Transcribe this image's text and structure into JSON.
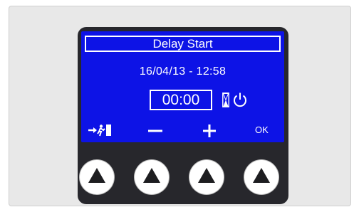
{
  "display": {
    "title": "Delay Start",
    "datetime": "16/04/13 - 12:58",
    "delay_time": "00:00",
    "status_icons": [
      "hourglass-icon",
      "power-icon"
    ]
  },
  "softkeys": {
    "exit_icon": "exit-arrow-icon",
    "minus_label": "−",
    "plus_label": "+",
    "ok_label": "OK"
  },
  "hardware_buttons": [
    "up-arrow-button",
    "up-arrow-button",
    "up-arrow-button",
    "up-arrow-button"
  ],
  "colors": {
    "screen": "#0d13e6",
    "device_body": "#27272c",
    "panel": "#e8e8e8",
    "text": "#ffffff"
  }
}
